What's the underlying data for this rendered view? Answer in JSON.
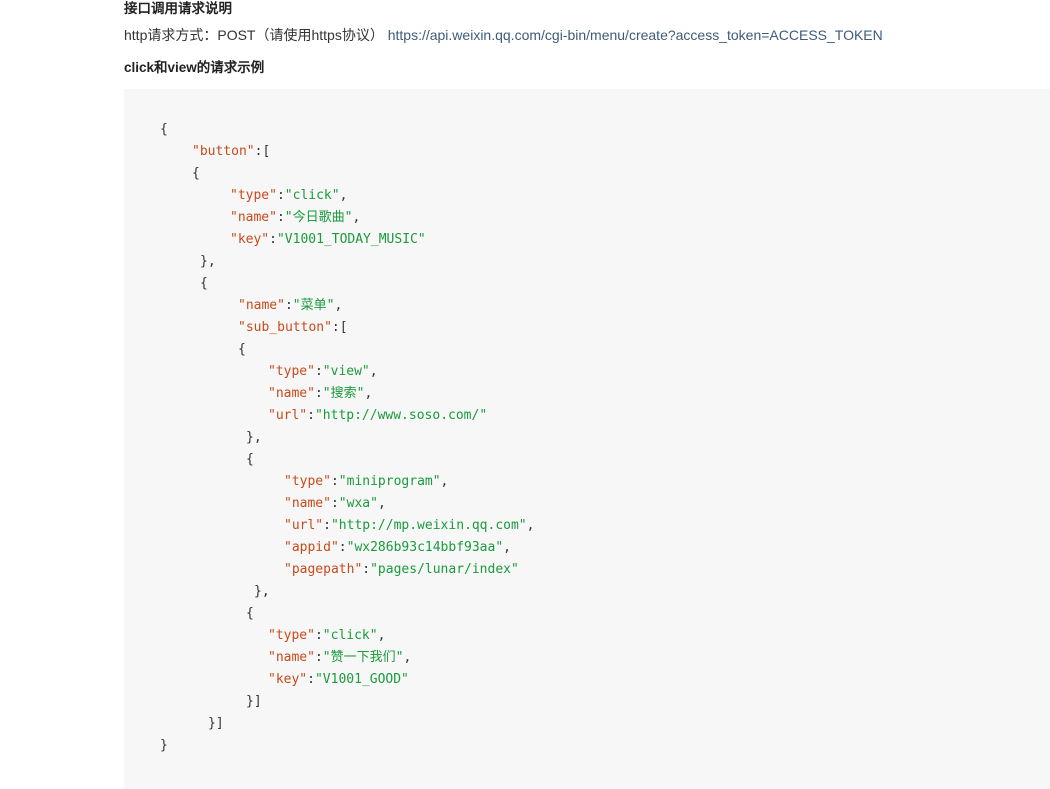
{
  "doc": {
    "section_title": "接口调用请求说明",
    "method_label": "http请求方式：POST（请使用https协议）",
    "endpoint_url": "https://api.weixin.qq.com/cgi-bin/menu/create?access_token=ACCESS_TOKEN",
    "example_title": "click和view的请求示例"
  },
  "code": {
    "lines": [
      {
        "indent": 0,
        "segments": [
          {
            "t": "p",
            "s": "{"
          }
        ]
      },
      {
        "indent": 1,
        "segments": [
          {
            "t": "k",
            "s": "\"button\""
          },
          {
            "t": "p",
            "s": ":["
          }
        ]
      },
      {
        "indent": 2,
        "segments": [
          {
            "t": "p",
            "s": "{"
          }
        ]
      },
      {
        "indent": 3,
        "segments": [
          {
            "t": "k",
            "s": "\"type\""
          },
          {
            "t": "p",
            "s": ":"
          },
          {
            "t": "v",
            "s": "\"click\""
          },
          {
            "t": "p",
            "s": ","
          }
        ]
      },
      {
        "indent": 4,
        "segments": [
          {
            "t": "k",
            "s": "\"name\""
          },
          {
            "t": "p",
            "s": ":"
          },
          {
            "t": "v",
            "s": "\"今日歌曲\""
          },
          {
            "t": "p",
            "s": ","
          }
        ]
      },
      {
        "indent": 5,
        "segments": [
          {
            "t": "k",
            "s": "\"key\""
          },
          {
            "t": "p",
            "s": ":"
          },
          {
            "t": "v",
            "s": "\"V1001_TODAY_MUSIC\""
          }
        ]
      },
      {
        "indent": 6,
        "segments": [
          {
            "t": "p",
            "s": "},"
          }
        ]
      },
      {
        "indent": 7,
        "segments": [
          {
            "t": "p",
            "s": "{"
          }
        ]
      },
      {
        "indent": 8,
        "segments": [
          {
            "t": "k",
            "s": "\"name\""
          },
          {
            "t": "p",
            "s": ":"
          },
          {
            "t": "v",
            "s": "\"菜单\""
          },
          {
            "t": "p",
            "s": ","
          }
        ]
      },
      {
        "indent": 9,
        "segments": [
          {
            "t": "k",
            "s": "\"sub_button\""
          },
          {
            "t": "p",
            "s": ":["
          }
        ]
      },
      {
        "indent": 10,
        "segments": [
          {
            "t": "p",
            "s": "{"
          }
        ]
      },
      {
        "indent": 11,
        "segments": [
          {
            "t": "k",
            "s": "\"type\""
          },
          {
            "t": "p",
            "s": ":"
          },
          {
            "t": "v",
            "s": "\"view\""
          },
          {
            "t": "p",
            "s": ","
          }
        ]
      },
      {
        "indent": 12,
        "segments": [
          {
            "t": "k",
            "s": "\"name\""
          },
          {
            "t": "p",
            "s": ":"
          },
          {
            "t": "v",
            "s": "\"搜索\""
          },
          {
            "t": "p",
            "s": ","
          }
        ]
      },
      {
        "indent": 13,
        "segments": [
          {
            "t": "k",
            "s": "\"url\""
          },
          {
            "t": "p",
            "s": ":"
          },
          {
            "t": "v",
            "s": "\"http://www.soso.com/\""
          }
        ]
      },
      {
        "indent": 14,
        "segments": [
          {
            "t": "p",
            "s": "},"
          }
        ]
      },
      {
        "indent": 15,
        "segments": [
          {
            "t": "p",
            "s": "{"
          }
        ]
      },
      {
        "indent": 16,
        "segments": [
          {
            "t": "k",
            "s": "\"type\""
          },
          {
            "t": "p",
            "s": ":"
          },
          {
            "t": "v",
            "s": "\"miniprogram\""
          },
          {
            "t": "p",
            "s": ","
          }
        ]
      },
      {
        "indent": 17,
        "segments": [
          {
            "t": "k",
            "s": "\"name\""
          },
          {
            "t": "p",
            "s": ":"
          },
          {
            "t": "v",
            "s": "\"wxa\""
          },
          {
            "t": "p",
            "s": ","
          }
        ]
      },
      {
        "indent": 18,
        "segments": [
          {
            "t": "k",
            "s": "\"url\""
          },
          {
            "t": "p",
            "s": ":"
          },
          {
            "t": "v",
            "s": "\"http://mp.weixin.qq.com\""
          },
          {
            "t": "p",
            "s": ","
          }
        ]
      },
      {
        "indent": 19,
        "segments": [
          {
            "t": "k",
            "s": "\"appid\""
          },
          {
            "t": "p",
            "s": ":"
          },
          {
            "t": "v",
            "s": "\"wx286b93c14bbf93aa\""
          },
          {
            "t": "p",
            "s": ","
          }
        ]
      },
      {
        "indent": 20,
        "segments": [
          {
            "t": "k",
            "s": "\"pagepath\""
          },
          {
            "t": "p",
            "s": ":"
          },
          {
            "t": "v",
            "s": "\"pages/lunar/index\""
          }
        ]
      },
      {
        "indent": 21,
        "segments": [
          {
            "t": "p",
            "s": "},"
          }
        ]
      },
      {
        "indent": 22,
        "segments": [
          {
            "t": "p",
            "s": "{"
          }
        ]
      },
      {
        "indent": 23,
        "segments": [
          {
            "t": "k",
            "s": "\"type\""
          },
          {
            "t": "p",
            "s": ":"
          },
          {
            "t": "v",
            "s": "\"click\""
          },
          {
            "t": "p",
            "s": ","
          }
        ]
      },
      {
        "indent": 24,
        "segments": [
          {
            "t": "k",
            "s": "\"name\""
          },
          {
            "t": "p",
            "s": ":"
          },
          {
            "t": "v",
            "s": "\"赞一下我们\""
          },
          {
            "t": "p",
            "s": ","
          }
        ]
      },
      {
        "indent": 25,
        "segments": [
          {
            "t": "k",
            "s": "\"key\""
          },
          {
            "t": "p",
            "s": ":"
          },
          {
            "t": "v",
            "s": "\"V1001_GOOD\""
          }
        ]
      },
      {
        "indent": 26,
        "segments": [
          {
            "t": "p",
            "s": "}]"
          }
        ]
      },
      {
        "indent": 27,
        "segments": [
          {
            "t": "p",
            "s": "}]"
          }
        ]
      },
      {
        "indent": 28,
        "segments": [
          {
            "t": "p",
            "s": "}"
          }
        ]
      }
    ]
  },
  "colors": {
    "key": "#c84a1a",
    "value": "#1a9b3c",
    "punct": "#333333",
    "code_bg": "#f7f7f7",
    "link": "#3f5a7a"
  }
}
